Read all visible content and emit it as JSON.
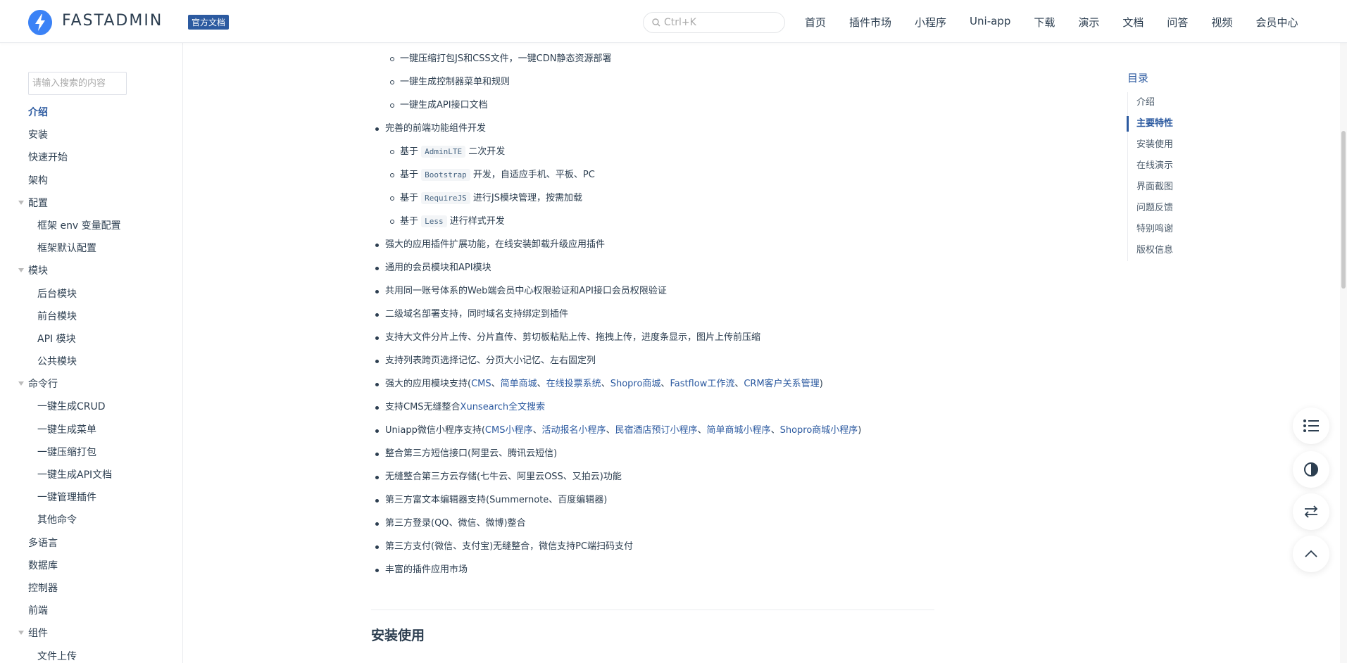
{
  "header": {
    "brand": "FASTADMIN",
    "badge": "官方文档",
    "search_placeholder": "Ctrl+K",
    "nav": [
      "首页",
      "插件市场",
      "小程序",
      "Uni-app",
      "下载",
      "演示",
      "文档",
      "问答",
      "视频",
      "会员中心"
    ]
  },
  "sidebar": {
    "search_placeholder": "请输入搜索的内容",
    "items": [
      {
        "label": "介绍",
        "level": 1,
        "active": true
      },
      {
        "label": "安装",
        "level": 1
      },
      {
        "label": "快速开始",
        "level": 1
      },
      {
        "label": "架构",
        "level": 1
      },
      {
        "label": "配置",
        "level": 1,
        "expanded": true
      },
      {
        "label": "框架 env 变量配置",
        "level": 2
      },
      {
        "label": "框架默认配置",
        "level": 2
      },
      {
        "label": "模块",
        "level": 1,
        "expanded": true
      },
      {
        "label": "后台模块",
        "level": 2
      },
      {
        "label": "前台模块",
        "level": 2
      },
      {
        "label": "API 模块",
        "level": 2
      },
      {
        "label": "公共模块",
        "level": 2
      },
      {
        "label": "命令行",
        "level": 1,
        "expanded": true
      },
      {
        "label": "一键生成CRUD",
        "level": 2
      },
      {
        "label": "一键生成菜单",
        "level": 2
      },
      {
        "label": "一键压缩打包",
        "level": 2
      },
      {
        "label": "一键生成API文档",
        "level": 2
      },
      {
        "label": "一键管理插件",
        "level": 2
      },
      {
        "label": "其他命令",
        "level": 2
      },
      {
        "label": "多语言",
        "level": 1
      },
      {
        "label": "数据库",
        "level": 1
      },
      {
        "label": "控制器",
        "level": 1
      },
      {
        "label": "前端",
        "level": 1
      },
      {
        "label": "组件",
        "level": 1,
        "expanded": true
      },
      {
        "label": "文件上传",
        "level": 2
      }
    ]
  },
  "content": {
    "sub_top": [
      "一键压缩打包JS和CSS文件，一键CDN静态资源部署",
      "一键生成控制器菜单和规则",
      "一键生成API接口文档"
    ],
    "frontend": {
      "label": "完善的前端功能组件开发",
      "items": [
        {
          "pre": "基于",
          "code": "AdminLTE",
          "post": "二次开发"
        },
        {
          "pre": "基于",
          "code": "Bootstrap",
          "post": "开发，自适应手机、平板、PC"
        },
        {
          "pre": "基于",
          "code": "RequireJS",
          "post": "进行JS模块管理，按需加载"
        },
        {
          "pre": "基于",
          "code": "Less",
          "post": "进行样式开发"
        }
      ]
    },
    "plain1": [
      "强大的应用插件扩展功能，在线安装卸载升级应用插件",
      "通用的会员模块和API模块",
      "共用同一账号体系的Web端会员中心权限验证和API接口会员权限验证",
      "二级域名部署支持，同时域名支持绑定到插件",
      "支持大文件分片上传、分片直传、剪切板粘贴上传、拖拽上传，进度条显示，图片上传前压缩",
      "支持列表跨页选择记忆、分页大小记忆、左右固定列"
    ],
    "modules": {
      "prefix": "强大的应用模块支持(",
      "links": [
        "CMS",
        "简单商城",
        "在线投票系统",
        "Shopro商城",
        "Fastflow工作流",
        "CRM客户关系管理"
      ],
      "suffix": ")"
    },
    "xunsearch": {
      "prefix": "支持CMS无缝整合",
      "link": "Xunsearch全文搜索"
    },
    "uniapp": {
      "prefix": "Uniapp微信小程序支持(",
      "links": [
        "CMS小程序",
        "活动报名小程序",
        "民宿酒店预订小程序",
        "简单商城小程序",
        "Shopro商城小程序"
      ],
      "suffix": ")"
    },
    "plain2": [
      "整合第三方短信接口(阿里云、腾讯云短信)",
      "无缝整合第三方云存储(七牛云、阿里云OSS、又拍云)功能",
      "第三方富文本编辑器支持(Summernote、百度编辑器)",
      "第三方登录(QQ、微信、微博)整合",
      "第三方支付(微信、支付宝)无缝整合，微信支持PC端扫码支付",
      "丰富的插件应用市场"
    ],
    "section_heading": "安装使用"
  },
  "toc": {
    "title": "目录",
    "items": [
      {
        "label": "介绍"
      },
      {
        "label": "主要特性",
        "active": true
      },
      {
        "label": "安装使用"
      },
      {
        "label": "在线演示"
      },
      {
        "label": "界面截图"
      },
      {
        "label": "问题反馈"
      },
      {
        "label": "特别鸣谢"
      },
      {
        "label": "版权信息"
      }
    ]
  },
  "fabs": [
    "toc-list-icon",
    "contrast-icon",
    "swap-arrows-icon",
    "chevron-up-icon"
  ],
  "colors": {
    "accent": "#2c5aa0",
    "text": "#2c3e50",
    "logo": "#3b82f6"
  }
}
